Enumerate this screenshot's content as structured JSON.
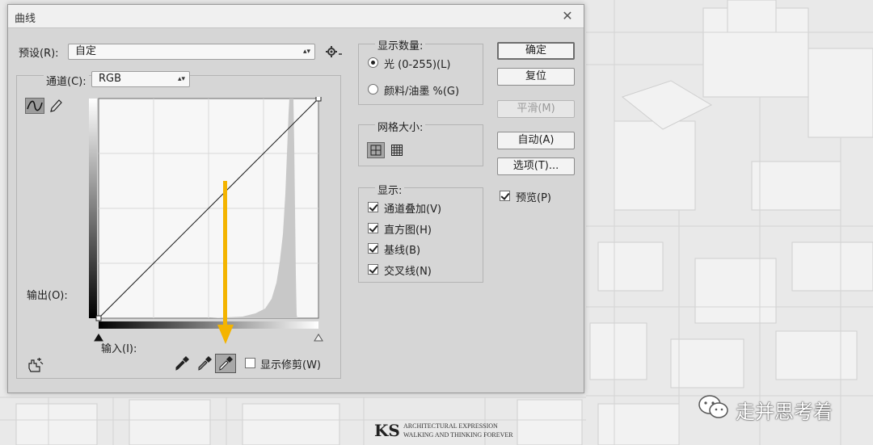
{
  "dialog": {
    "title": "曲线",
    "close_glyph": "✕",
    "preset_label": "预设(R):",
    "preset_value": "自定",
    "channel_label": "通道(C):",
    "channel_value": "RGB",
    "output_label": "输出(O):",
    "input_label": "输入(I):",
    "show_clipping_label": "显示修剪(W)",
    "show_clipping_checked": false
  },
  "display_amount": {
    "title": "显示数量:",
    "options": [
      {
        "label": "光 (0-255)(L)",
        "selected": true
      },
      {
        "label": "颜料/油墨 %(G)",
        "selected": false
      }
    ]
  },
  "grid_size": {
    "title": "网格大小:",
    "selected": "simple-grid"
  },
  "display": {
    "title": "显示:",
    "items": [
      {
        "label": "通道叠加(V)",
        "checked": true
      },
      {
        "label": "直方图(H)",
        "checked": true
      },
      {
        "label": "基线(B)",
        "checked": true
      },
      {
        "label": "交叉线(N)",
        "checked": true
      }
    ]
  },
  "buttons": {
    "ok": "确定",
    "reset": "复位",
    "smooth": "平滑(M)",
    "auto": "自动(A)",
    "options": "选项(T)...",
    "smooth_disabled": true
  },
  "preview": {
    "label": "预览(P)",
    "checked": true
  },
  "tools": {
    "curve_tool": "curve-point-icon",
    "pencil_tool": "pencil-icon",
    "target_tool": "on-image-adjust-icon",
    "eyedroppers": [
      "black-eyedropper-icon",
      "gray-eyedropper-icon",
      "white-eyedropper-icon"
    ],
    "selected_eyedropper": "white-eyedropper-icon"
  },
  "annotation": {
    "arrow_color": "#f4b400"
  },
  "watermark": {
    "logo": "KS",
    "line1": "ARCHITECTURAL EXPRESSION",
    "line2": "WALKING AND THINKING FOREVER",
    "account": "走并思考着"
  }
}
